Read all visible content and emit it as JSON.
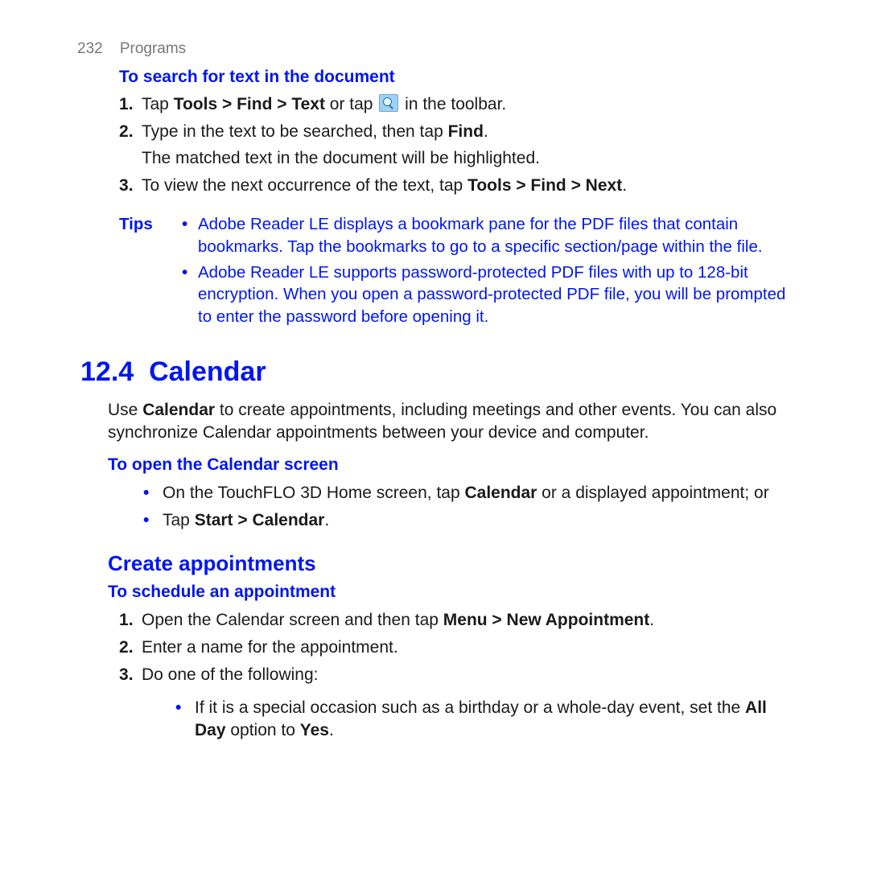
{
  "header": {
    "page_num": "232",
    "section": "Programs"
  },
  "search": {
    "title": "To search for text in the document",
    "s1_a": "Tap ",
    "s1_b": "Tools > Find > Text",
    "s1_c": " or tap ",
    "s1_d": " in the toolbar.",
    "s2_a": "Type in the text to be searched, then tap ",
    "s2_b": "Find",
    "s2_c": ".",
    "s2_note": "The matched text in the document will be highlighted.",
    "s3_a": "To view the next occurrence of the text, tap ",
    "s3_b": "Tools > Find > Next",
    "s3_c": "."
  },
  "tips": {
    "label": "Tips",
    "t1": "Adobe Reader LE displays a bookmark pane for the PDF files that contain bookmarks. Tap the bookmarks to go to a specific section/page within the file.",
    "t2": "Adobe Reader LE supports password-protected PDF files with up to 128-bit encryption. When you open a password-protected PDF file, you will be prompted to enter the password before opening it."
  },
  "calendar": {
    "head": "12.4  Calendar",
    "intro_a": "Use ",
    "intro_b": "Calendar",
    "intro_c": " to create appointments, including meetings and other events. You can also synchronize Calendar appointments between your device and computer.",
    "open_title": "To open the Calendar screen",
    "open_b1_a": "On the TouchFLO 3D Home screen, tap ",
    "open_b1_b": "Calendar",
    "open_b1_c": " or a displayed appointment; or",
    "open_b2_a": "Tap ",
    "open_b2_b": "Start > Calendar",
    "open_b2_c": ".",
    "create_head": "Create appointments",
    "sched_title": "To schedule an appointment",
    "sched_s1_a": "Open the Calendar screen and then tap ",
    "sched_s1_b": "Menu > New Appointment",
    "sched_s1_c": ".",
    "sched_s2": "Enter a name for the appointment.",
    "sched_s3": "Do one of the following:",
    "sched_sb_a": "If it is a special occasion such as a birthday or a whole-day event, set the ",
    "sched_sb_b": "All Day",
    "sched_sb_c": " option to ",
    "sched_sb_d": "Yes",
    "sched_sb_e": "."
  }
}
